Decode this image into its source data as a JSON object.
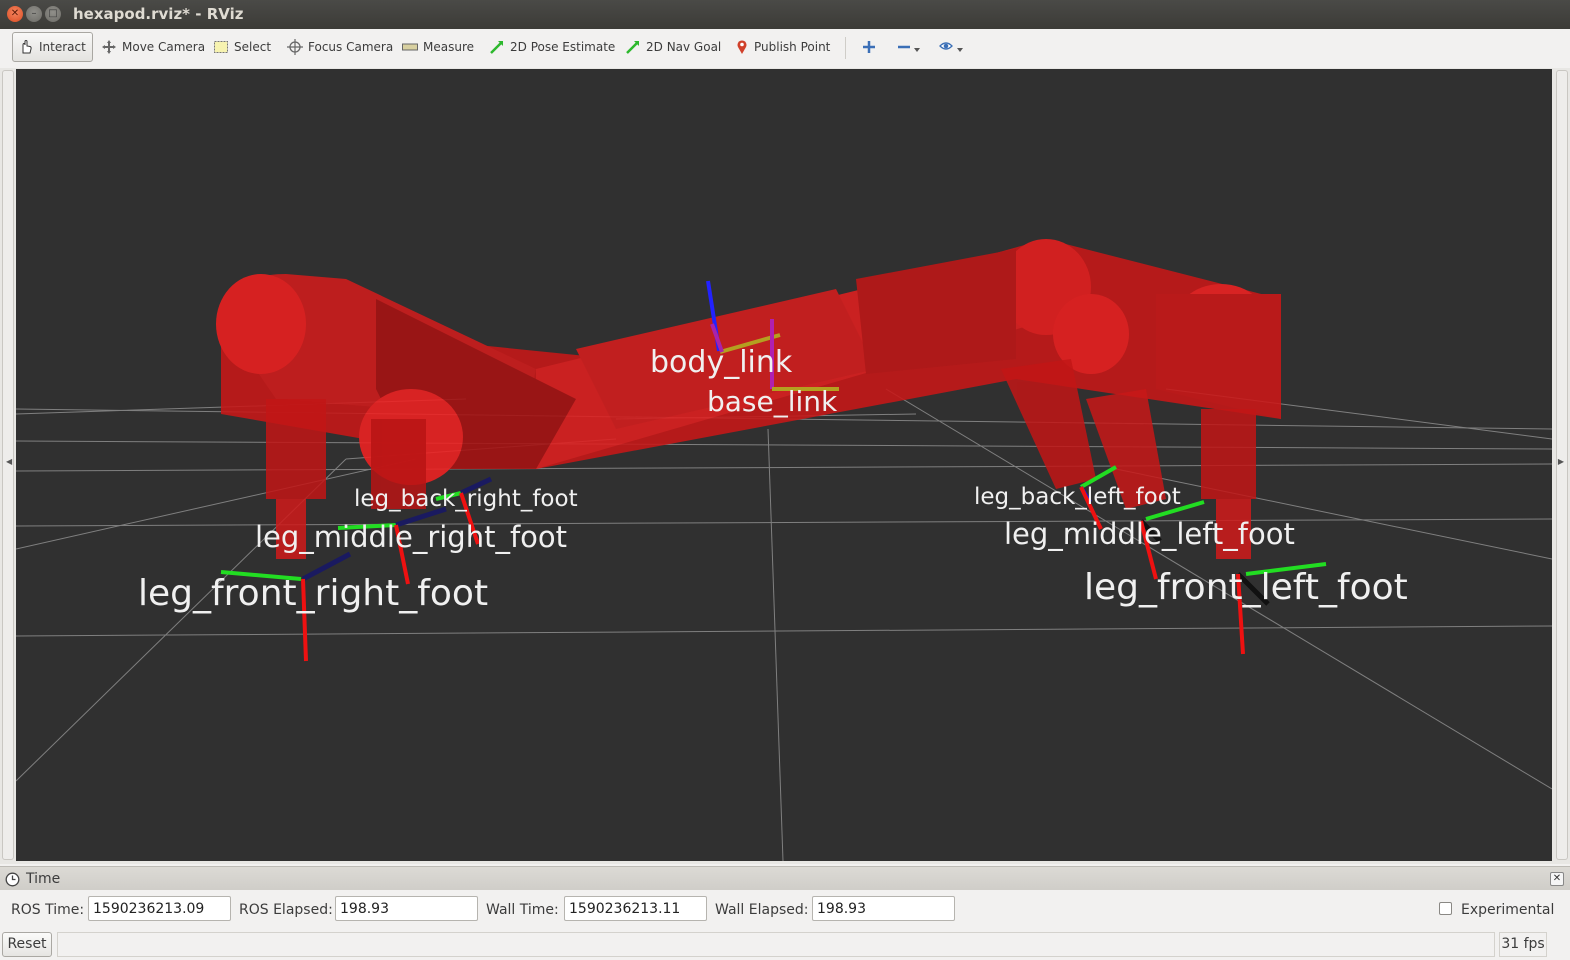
{
  "window": {
    "title": "hexapod.rviz* - RViz"
  },
  "toolbar": {
    "interact": "Interact",
    "move_camera": "Move Camera",
    "select": "Select",
    "focus_camera": "Focus Camera",
    "measure": "Measure",
    "pose_estimate": "2D Pose Estimate",
    "nav_goal": "2D Nav Goal",
    "publish_point": "Publish Point"
  },
  "viewport": {
    "background": "#303030",
    "frame_labels": {
      "body_link": "body_link",
      "base_link": "base_link",
      "leg_back_right_foot": "leg_back_right_foot",
      "leg_middle_right_foot": "leg_middle_right_foot",
      "leg_front_right_foot": "leg_front_right_foot",
      "leg_back_left_foot": "leg_back_left_foot",
      "leg_middle_left_foot": "leg_middle_left_foot",
      "leg_front_left_foot": "leg_front_left_foot"
    }
  },
  "time_panel": {
    "title": "Time",
    "ros_time_label": "ROS Time:",
    "ros_time": "1590236213.09",
    "ros_elapsed_label": "ROS Elapsed:",
    "ros_elapsed": "198.93",
    "wall_time_label": "Wall Time:",
    "wall_time": "1590236213.11",
    "wall_elapsed_label": "Wall Elapsed:",
    "wall_elapsed": "198.93",
    "experimental_label": "Experimental"
  },
  "footer": {
    "reset_label": "Reset",
    "fps": "31 fps"
  }
}
